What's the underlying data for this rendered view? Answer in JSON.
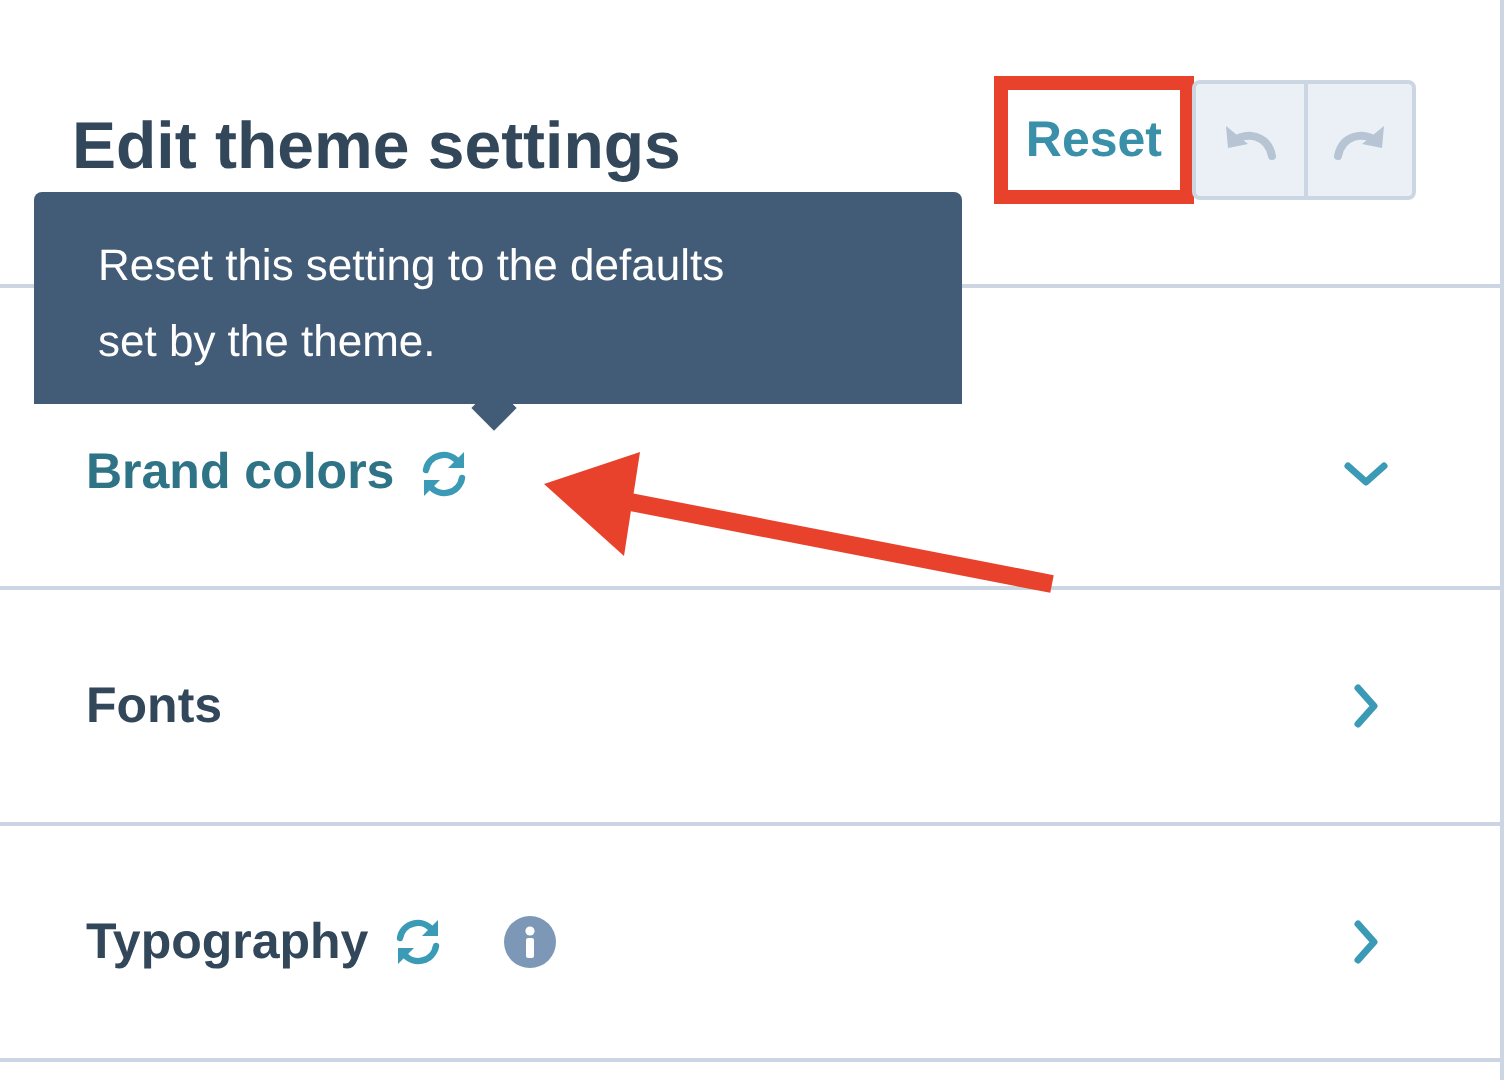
{
  "header": {
    "title": "Edit theme settings",
    "reset_button": {
      "label": "Reset",
      "highlighted": true
    }
  },
  "tooltip": {
    "text": "Reset this setting to the defaults set by the theme."
  },
  "sections": [
    {
      "label": "Brand colors",
      "expanded": true,
      "reset": true,
      "info": false
    },
    {
      "label": "Fonts",
      "expanded": false,
      "reset": false,
      "info": false
    },
    {
      "label": "Typography",
      "expanded": false,
      "reset": true,
      "info": true
    }
  ]
}
